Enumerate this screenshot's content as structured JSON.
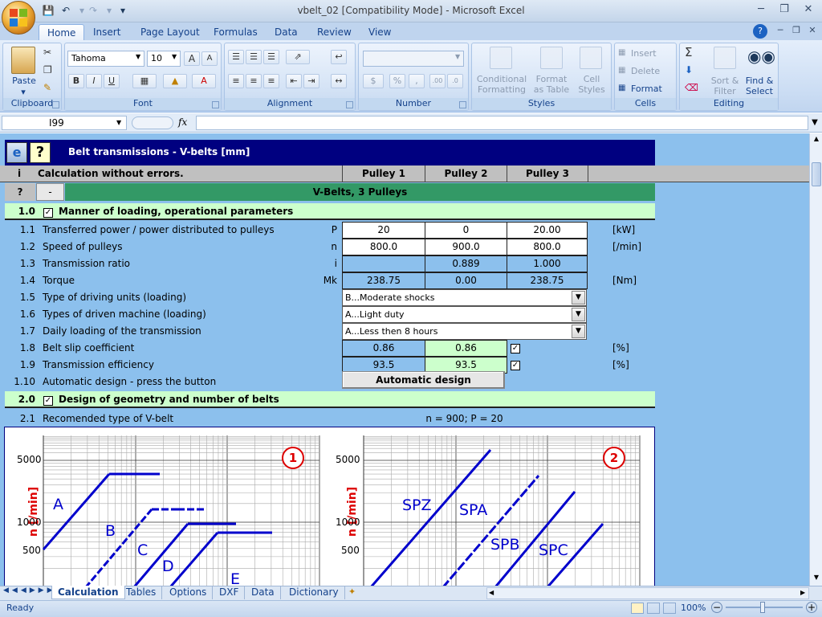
{
  "window": {
    "title": "vbelt_02  [Compatibility Mode] - Microsoft Excel"
  },
  "ribbon": {
    "tabs": [
      "Home",
      "Insert",
      "Page Layout",
      "Formulas",
      "Data",
      "Review",
      "View"
    ],
    "active_tab": "Home",
    "clipboard": {
      "paste": "Paste",
      "label": "Clipboard"
    },
    "font": {
      "name": "Tahoma",
      "size": "10",
      "label": "Font"
    },
    "alignment": {
      "label": "Alignment"
    },
    "number": {
      "label": "Number",
      "currency": "$",
      "percent": "%",
      "comma": ","
    },
    "styles": {
      "conditional": "Conditional Formatting",
      "format_table": "Format as Table",
      "cell_styles": "Cell Styles",
      "label": "Styles"
    },
    "cells": {
      "insert": "Insert",
      "delete": "Delete",
      "format": "Format",
      "label": "Cells"
    },
    "editing": {
      "sigma": "Σ",
      "sort": "Sort & Filter",
      "find": "Find & Select",
      "label": "Editing"
    }
  },
  "formula_bar": {
    "name_box": "I99",
    "fx": "fx",
    "formula": ""
  },
  "sheet": {
    "header_title": "Belt transmissions - V-belts [mm]",
    "status_i": "i",
    "status_text": "Calculation without errors.",
    "pulley_headers": [
      "Pulley 1",
      "Pulley 2",
      "Pulley 3"
    ],
    "help_q": "?",
    "help_dash": "-",
    "banner": "V-Belts, 3 Pulleys",
    "section1": {
      "num": "1.0",
      "title": "Manner of loading, operational parameters"
    },
    "rows": [
      {
        "num": "1.1",
        "label": "Transferred power / power distributed to pulleys",
        "sym": "P",
        "v1": "20",
        "v2": "0",
        "v3": "20.00",
        "unit": "[kW]"
      },
      {
        "num": "1.2",
        "label": "Speed of pulleys",
        "sym": "n",
        "v1": "800.0",
        "v2": "900.0",
        "v3": "800.0",
        "unit": "[/min]"
      },
      {
        "num": "1.3",
        "label": "Transmission ratio",
        "sym": "i",
        "v1": "",
        "v2": "0.889",
        "v3": "1.000",
        "unit": ""
      },
      {
        "num": "1.4",
        "label": "Torque",
        "sym": "Mk",
        "v1": "238.75",
        "v2": "0.00",
        "v3": "238.75",
        "unit": "[Nm]"
      }
    ],
    "dropdowns": [
      {
        "num": "1.5",
        "label": "Type of driving units (loading)",
        "value": "B...Moderate shocks"
      },
      {
        "num": "1.6",
        "label": "Types of driven machine (loading)",
        "value": "A...Light duty"
      },
      {
        "num": "1.7",
        "label": "Daily loading of the transmission",
        "value": "A...Less then 8 hours"
      }
    ],
    "slip": {
      "num": "1.8",
      "label": "Belt slip coefficient",
      "v1": "0.86",
      "v2": "0.86",
      "unit": "[%]"
    },
    "eff": {
      "num": "1.9",
      "label": "Transmission efficiency",
      "v1": "93.5",
      "v2": "93.5",
      "unit": "[%]"
    },
    "auto": {
      "num": "1.10",
      "label": "Automatic design - press the button",
      "button": "Automatic design"
    },
    "section2": {
      "num": "2.0",
      "title": "Design of geometry and number of belts"
    },
    "recommended": {
      "num": "2.1",
      "label": "Recomended type of V-belt",
      "value": "n = 900; P = 20"
    }
  },
  "chart1": {
    "badge": "1",
    "ylabel": "n [/min]",
    "yticks": [
      "5000",
      "1000",
      "500"
    ],
    "belts": [
      "A",
      "B",
      "C",
      "D",
      "E"
    ]
  },
  "chart2": {
    "badge": "2",
    "ylabel": "n [/min]",
    "yticks": [
      "5000",
      "1000",
      "500"
    ],
    "belts": [
      "SPZ",
      "SPA",
      "SPB",
      "SPC"
    ]
  },
  "sheet_tabs": [
    "Calculation",
    "Tables",
    "Options",
    "DXF",
    "Data",
    "Dictionary"
  ],
  "active_sheet": "Calculation",
  "status": {
    "ready": "Ready",
    "zoom": "100%"
  },
  "colors": {
    "sheet_bg": "#8cc0ed",
    "header_navy": "#000080",
    "banner_green": "#339966",
    "section_green": "#ccffcc",
    "belt_blue": "#0000cc",
    "badge_red": "#dd0000"
  }
}
